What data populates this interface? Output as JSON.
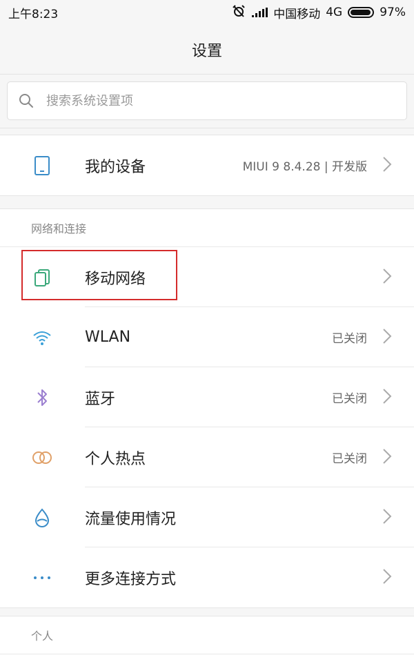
{
  "status_bar": {
    "time": "上午8:23",
    "carrier": "中国移动",
    "network": "4G",
    "battery": "97%",
    "battery_level": 0.97
  },
  "header": {
    "title": "设置"
  },
  "search": {
    "placeholder": "搜索系统设置项"
  },
  "device": {
    "label": "我的设备",
    "value": "MIUI 9 8.4.28 | 开发版"
  },
  "network_section": {
    "header": "网络和连接",
    "items": [
      {
        "label": "移动网络",
        "value": "",
        "icon": "mobile-network-icon"
      },
      {
        "label": "WLAN",
        "value": "已关闭",
        "icon": "wifi-icon"
      },
      {
        "label": "蓝牙",
        "value": "已关闭",
        "icon": "bluetooth-icon"
      },
      {
        "label": "个人热点",
        "value": "已关闭",
        "icon": "hotspot-icon"
      },
      {
        "label": "流量使用情况",
        "value": "",
        "icon": "data-usage-icon"
      },
      {
        "label": "更多连接方式",
        "value": "",
        "icon": "more-icon"
      }
    ]
  },
  "personal_section": {
    "header": "个人"
  },
  "colors": {
    "highlight": "#d42b2b",
    "device_icon": "#3a8cc8",
    "network_icon": "#3aa87a",
    "wifi_icon": "#3aa0d8",
    "bluetooth_icon": "#9b7fd0",
    "hotspot_icon": "#e0a068",
    "data_icon": "#3a8cc8",
    "more_icon": "#3a8cc8"
  }
}
